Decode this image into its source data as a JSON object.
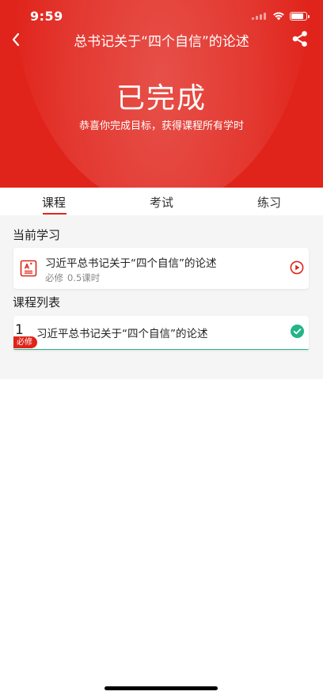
{
  "status_bar": {
    "time": "9:59"
  },
  "nav": {
    "title": "总书记关于“四个自信”的论述"
  },
  "hero": {
    "status": "已完成",
    "subtitle": "恭喜你完成目标，获得课程所有学时"
  },
  "tabs": [
    {
      "label": "课程",
      "active": true
    },
    {
      "label": "考试",
      "active": false
    },
    {
      "label": "练习",
      "active": false
    }
  ],
  "current_section": {
    "title": "当前学习",
    "item": {
      "title": "习近平总书记关于“四个自信”的论述",
      "tag": "必修",
      "hours": "0.5课时"
    }
  },
  "list_section": {
    "title": "课程列表",
    "items": [
      {
        "index": "1",
        "title": "习近平总书记关于“四个自信”的论述",
        "badge": "必修",
        "completed": true
      }
    ]
  },
  "colors": {
    "brand_red": "#e0241b",
    "complete_green": "#22b586",
    "background": "#f5f5f5"
  },
  "icons": {
    "back": "chevron-left-icon",
    "share": "share-icon",
    "document": "document-icon",
    "play": "play-circle-icon",
    "check": "check-circle-icon"
  }
}
